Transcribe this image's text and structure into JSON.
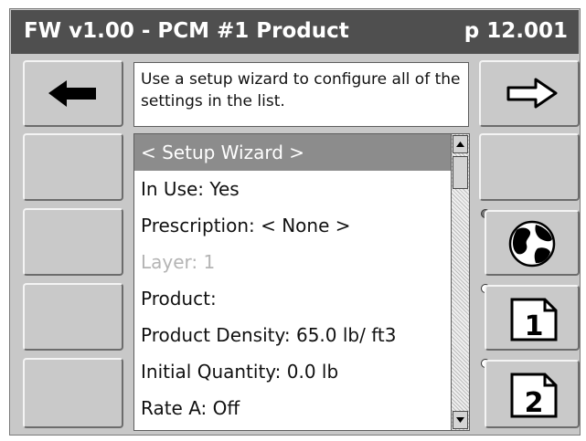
{
  "header": {
    "title": "FW v1.00 - PCM #1 Product",
    "page": "p 12.001"
  },
  "message": {
    "text": "Use a setup wizard to configure all of the settings in the list."
  },
  "list": {
    "items": [
      {
        "label": "< Setup Wizard >",
        "state": "selected"
      },
      {
        "label": "In Use: Yes",
        "state": "normal"
      },
      {
        "label": "Prescription: < None >",
        "state": "normal"
      },
      {
        "label": "Layer: 1",
        "state": "disabled"
      },
      {
        "label": "Product:",
        "state": "normal"
      },
      {
        "label": "Product Density: 65.0 lb/ ft3",
        "state": "normal"
      },
      {
        "label": "Initial Quantity: 0.0 lb",
        "state": "normal"
      },
      {
        "label": "Rate A: Off",
        "state": "normal"
      }
    ]
  },
  "right_buttons": {
    "globe_icon": "globe-icon",
    "page1_label": "1",
    "page2_label": "2"
  },
  "colors": {
    "title_bg": "#4f4f4f",
    "selection": "#8c8c8c",
    "panel": "#c9c9c9"
  }
}
